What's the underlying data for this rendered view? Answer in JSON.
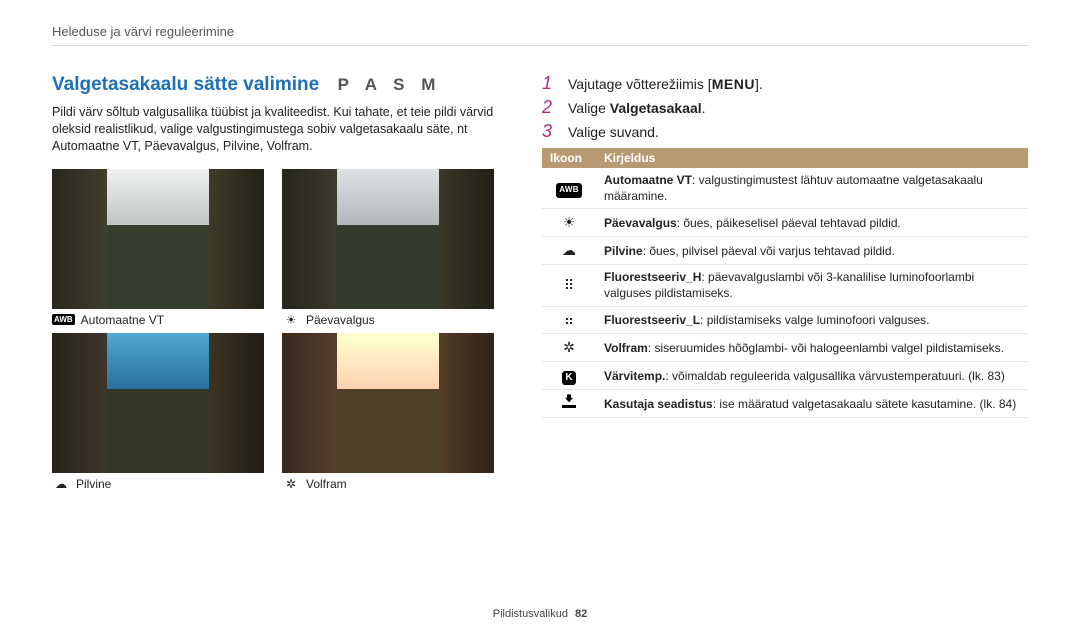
{
  "breadcrumb": "Heleduse ja värvi reguleerimine",
  "section_title": "Valgetasakaalu sätte valimine",
  "modes": "P A S M",
  "intro": "Pildi värv sõltub valgusallika tüübist ja kvaliteedist. Kui tahate, et teie pildi värvid oleksid realistlikud, valige valgustingimustega sobiv valgetasakaalu säte, nt Automaatne VT, Päevavalgus, Pilvine, Volfram.",
  "thumbs": {
    "tl": "Automaatne VT",
    "tr": "Päevavalgus",
    "bl": "Pilvine",
    "br": "Volfram",
    "tl_badge": "AWB"
  },
  "steps": {
    "s1_pre": "Vajutage võtterežiimis [",
    "s1_menu": "MENU",
    "s1_post": "].",
    "s2_pre": "Valige ",
    "s2_bold": "Valgetasakaal",
    "s2_post": ".",
    "s3": "Valige suvand."
  },
  "table": {
    "h1": "Ikoon",
    "h2": "Kirjeldus",
    "rows": [
      {
        "ic": "awb",
        "b": "Automaatne VT",
        "t": ": valgustingimustest lähtuv automaatne valgetasakaalu määramine."
      },
      {
        "ic": "sun",
        "b": "Päevavalgus",
        "t": ": õues, päikeselisel päeval tehtavad pildid."
      },
      {
        "ic": "cloud",
        "b": "Pilvine",
        "t": ": õues, pilvisel päeval või varjus tehtavad pildid."
      },
      {
        "ic": "flH",
        "b": "Fluorestseeriv_H",
        "t": ": päevavalguslambi või 3-kanalilise luminofoorlambi valguses pildistamiseks."
      },
      {
        "ic": "flL",
        "b": "Fluorestseeriv_L",
        "t": ": pildistamiseks valge luminofoori valguses."
      },
      {
        "ic": "bulb",
        "b": "Volfram",
        "t": ": siseruumides hõõglambi- või halogeenlambi valgel pildistamiseks."
      },
      {
        "ic": "k",
        "b": "Värvitemp.",
        "t": ": võimaldab reguleerida valgusallika värvustemperatuuri. (lk. 83)"
      },
      {
        "ic": "dl",
        "b": "Kasutaja seadistus",
        "t": ": ise määratud valgetasakaalu sätete kasutamine. (lk. 84)"
      }
    ]
  },
  "footer": {
    "label": "Pildistusvalikud",
    "page": "82"
  }
}
